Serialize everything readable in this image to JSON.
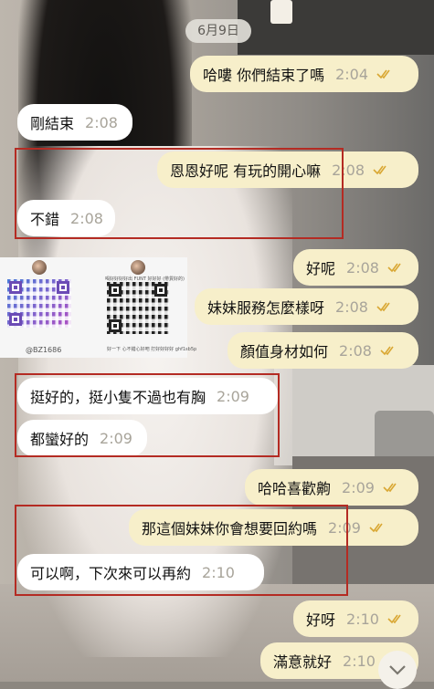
{
  "colors": {
    "outgoing_bubble": "#f7efca",
    "incoming_bubble": "#ffffff",
    "read_ticks": "#d9a733",
    "highlight_frame": "#b42b23"
  },
  "date_chip": "6月9日",
  "messages": [
    {
      "dir": "out",
      "text": "哈嘍 你們結束了嗎",
      "time": "2:04",
      "ticks": "read"
    },
    {
      "dir": "in",
      "text": "剛結束",
      "time": "2:08"
    },
    {
      "dir": "out",
      "text": "恩恩好呢 有玩的開心嘛",
      "time": "2:08",
      "ticks": "read"
    },
    {
      "dir": "in",
      "text": "不錯",
      "time": "2:08"
    },
    {
      "dir": "out",
      "text": "好呢",
      "time": "2:08",
      "ticks": "read"
    },
    {
      "dir": "out",
      "text": "妹妹服務怎麼樣呀",
      "time": "2:08",
      "ticks": "read"
    },
    {
      "dir": "out",
      "text": "顏值身材如何",
      "time": "2:08",
      "ticks": "read"
    },
    {
      "dir": "in",
      "text": "挺好的，挺小隻不過也有胸",
      "time": "2:09"
    },
    {
      "dir": "in",
      "text": "都蠻好的",
      "time": "2:09"
    },
    {
      "dir": "out",
      "text": "哈哈喜歡齁",
      "time": "2:09",
      "ticks": "read"
    },
    {
      "dir": "out",
      "text": "那這個妹妹你會想要回約嗎",
      "time": "2:09",
      "ticks": "read"
    },
    {
      "dir": "in",
      "text": "可以啊，下次來可以再約",
      "time": "2:10"
    },
    {
      "dir": "out",
      "text": "好呀",
      "time": "2:10",
      "ticks": "read"
    },
    {
      "dir": "out",
      "text": "滿意就好",
      "time": "2:10",
      "ticks": "read"
    }
  ],
  "ad_overlay": {
    "left_caption": "@BZ1686",
    "right_header": "喝好好好好出 FUNT  好好好 (帶貨好的)",
    "right_footer": "好一下 心不錯心好吧   打好好好好 ghf1sb5p"
  },
  "icons": {
    "ticks": "double-check-icon",
    "scroll": "chevron-down-icon"
  }
}
